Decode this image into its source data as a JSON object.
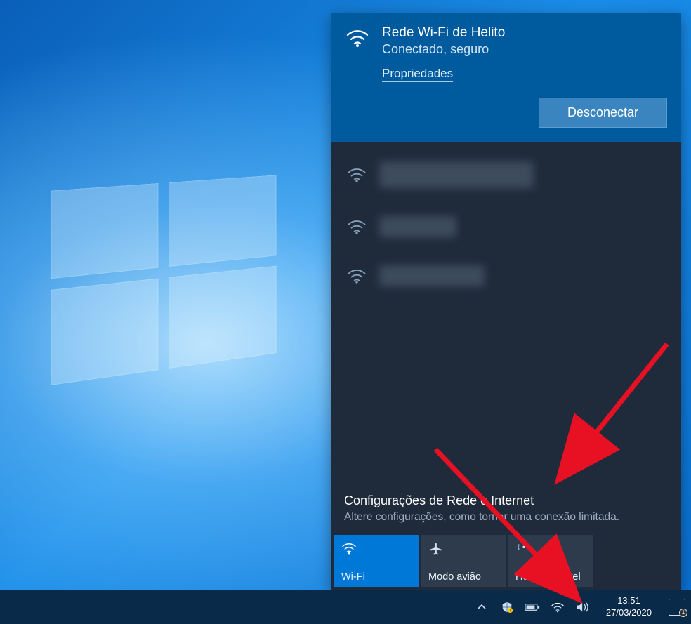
{
  "connected": {
    "ssid": "Rede Wi-Fi de Helito",
    "status": "Conectado, seguro",
    "properties_link": "Propriedades",
    "disconnect_label": "Desconectar"
  },
  "other_networks": [
    {
      "id": "redacted-1"
    },
    {
      "id": "redacted-2"
    },
    {
      "id": "redacted-3"
    }
  ],
  "settings": {
    "title": "Configurações de Rede e Internet",
    "subtitle": "Altere configurações, como tornar uma conexão limitada."
  },
  "tiles": {
    "wifi": "Wi-Fi",
    "airplane": "Modo avião",
    "hotspot": "Hotspot móvel"
  },
  "taskbar": {
    "time": "13:51",
    "date": "27/03/2020",
    "notif_count": "1"
  }
}
